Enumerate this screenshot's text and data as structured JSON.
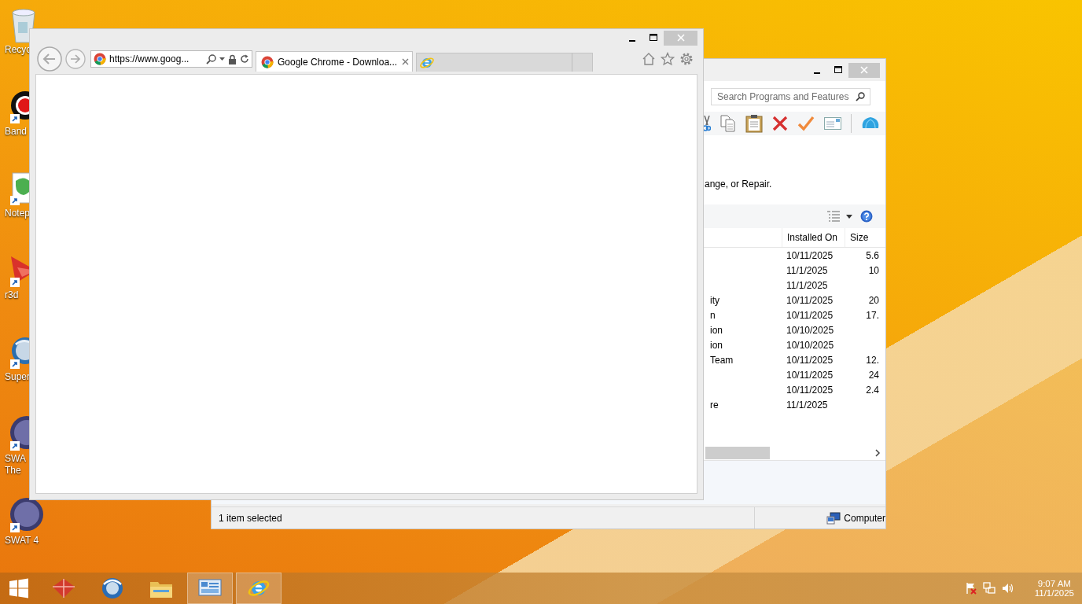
{
  "desktop_icons": [
    {
      "kind": "bin",
      "label": "Recyc"
    },
    {
      "kind": "record",
      "label": "Band"
    },
    {
      "kind": "notepad",
      "label": "Notep"
    },
    {
      "kind": "shape",
      "label": "r3d"
    },
    {
      "kind": "globe",
      "label": "Super"
    },
    {
      "kind": "person",
      "label": "SWA\nThe"
    },
    {
      "kind": "person",
      "label": "SWAT 4"
    }
  ],
  "ie_window": {
    "address": "https://www.goog...",
    "tabs": [
      {
        "title": "Google Chrome - Downloa...",
        "selected": true
      }
    ]
  },
  "programs_window": {
    "search": {
      "placeholder": "Search Programs and Features"
    },
    "description": "ange, or Repair.",
    "columns": [
      "Installed On",
      "Size"
    ],
    "rows": [
      {
        "installed_on": "10/11/2025",
        "size": "5.6"
      },
      {
        "installed_on": "11/1/2025",
        "size": "10"
      },
      {
        "installed_on": "11/1/2025"
      },
      {
        "name": "ity",
        "installed_on": "10/11/2025",
        "size": "20"
      },
      {
        "name": "n",
        "installed_on": "10/11/2025",
        "size": "17."
      },
      {
        "name": "ion",
        "installed_on": "10/10/2025"
      },
      {
        "name": "ion",
        "installed_on": "10/10/2025"
      },
      {
        "name": "Team",
        "installed_on": "10/11/2025",
        "size": "12."
      },
      {
        "installed_on": "10/11/2025",
        "size": "24"
      },
      {
        "installed_on": "10/11/2025",
        "size": "2.4"
      },
      {
        "name": "re",
        "installed_on": "11/1/2025"
      }
    ],
    "status": "1 item selected",
    "location": "Computer"
  },
  "taskbar": {
    "apps": [
      {
        "kind": "cube",
        "active": false
      },
      {
        "kind": "globe",
        "active": false
      },
      {
        "kind": "folder",
        "active": false
      },
      {
        "kind": "panel",
        "active": true
      },
      {
        "kind": "browser",
        "active": true
      }
    ],
    "time": "9:07 AM",
    "date": "11/1/2025"
  }
}
